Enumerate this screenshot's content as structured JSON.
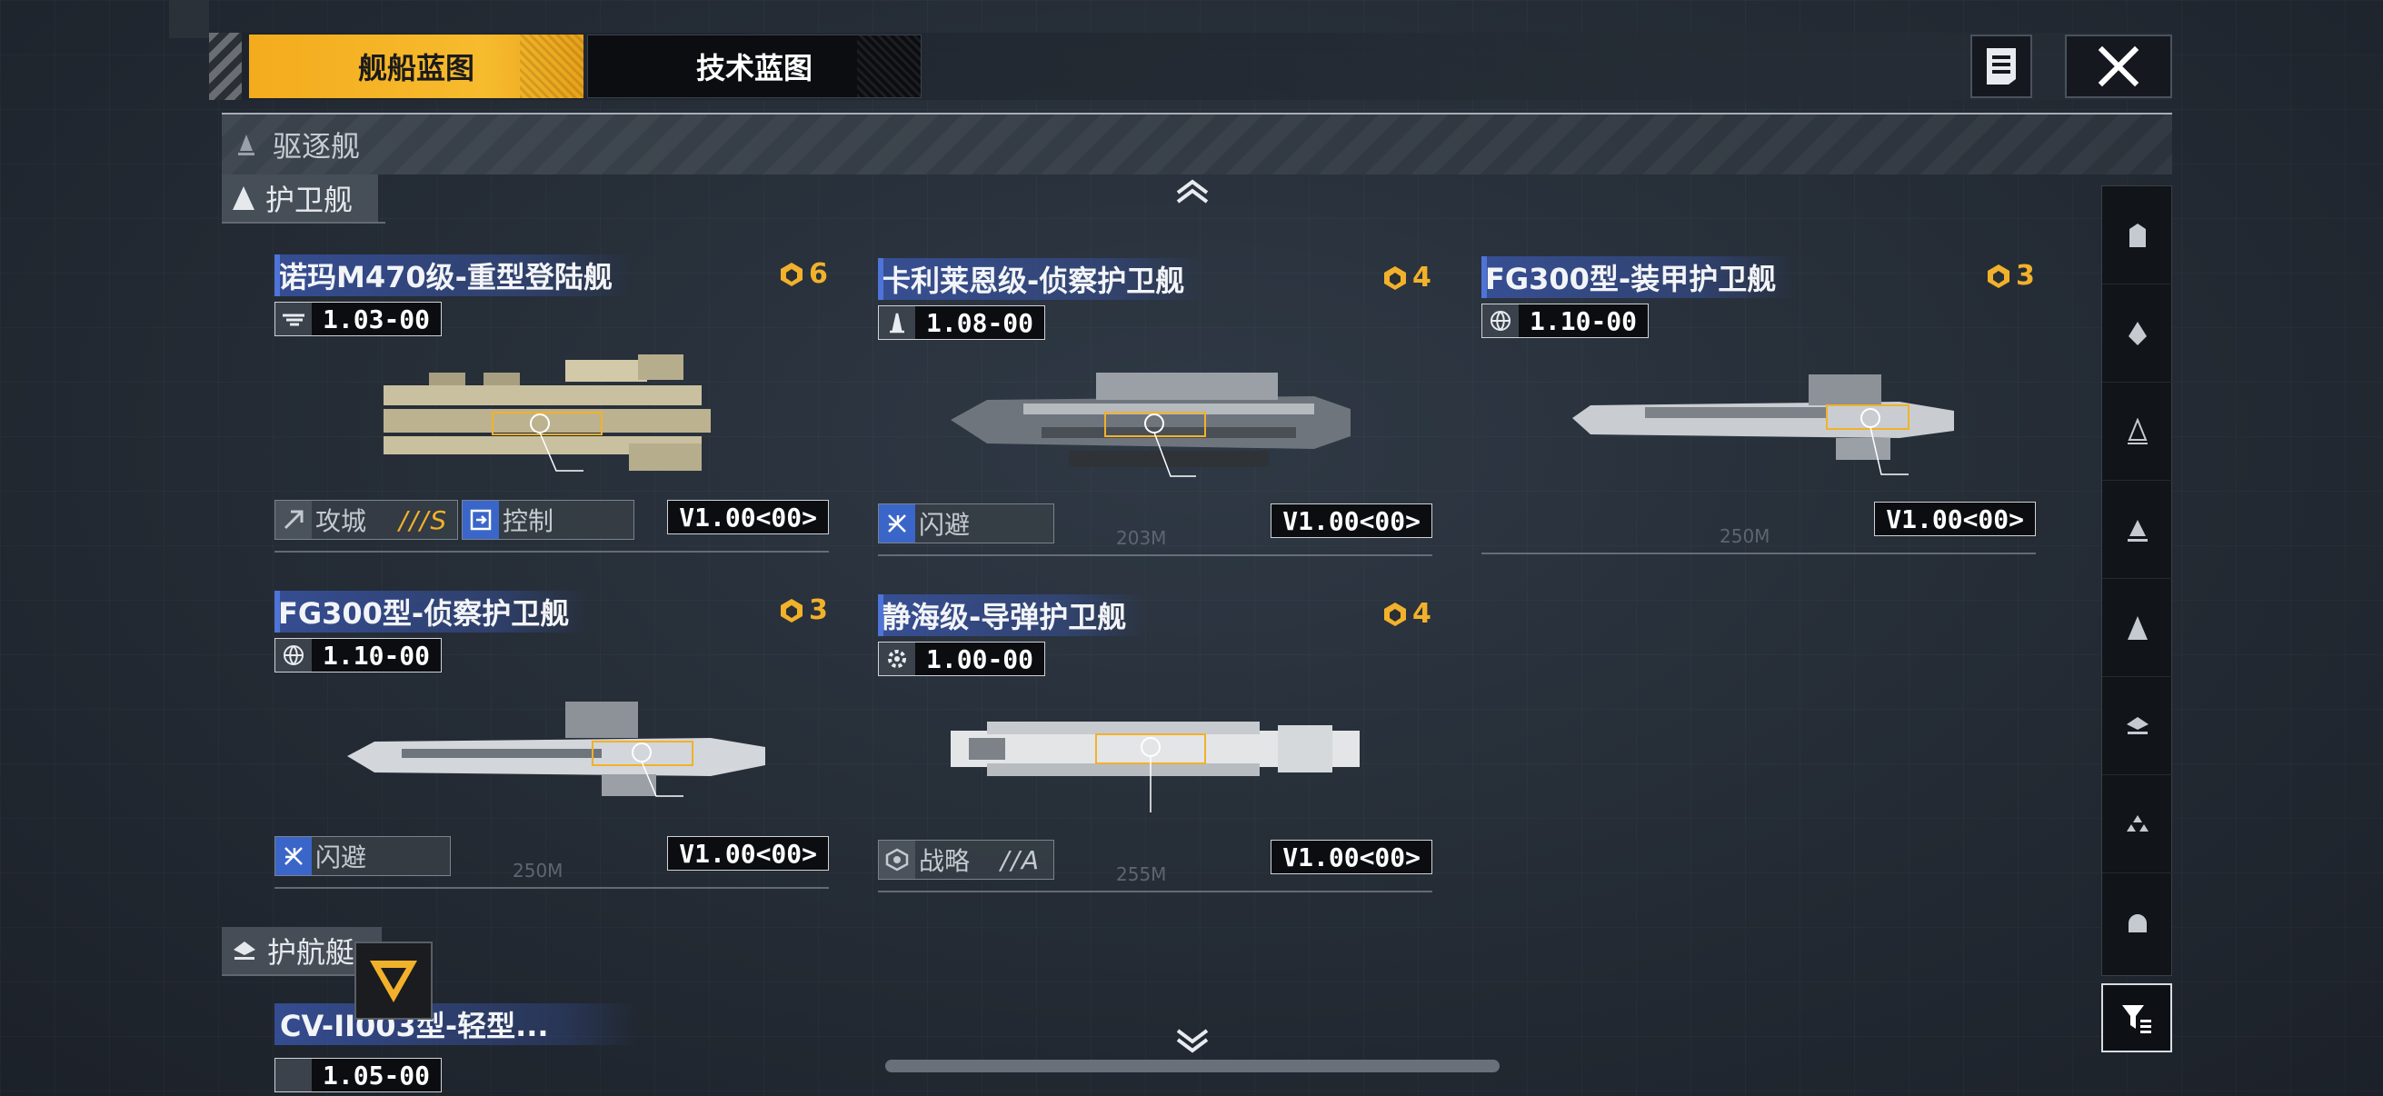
{
  "tabs": {
    "ship_blueprint": "舰船蓝图",
    "tech_blueprint": "技术蓝图"
  },
  "icons": {
    "notes": "notes-icon",
    "close": "close-icon"
  },
  "sections": {
    "destroyer": "驱逐舰",
    "frigate": "护卫舰",
    "escort": "护航艇"
  },
  "ships": [
    {
      "name": "诺玛M470级-重型登陆舰",
      "cost": "6",
      "version": "1.03",
      "version_suffix": "00",
      "tags": [
        {
          "label": "攻城",
          "grade": "///S",
          "style": "gray"
        },
        {
          "label": "控制",
          "grade": "",
          "style": "blue"
        }
      ],
      "version_tag": "V1.00<00>"
    },
    {
      "name": "卡利莱恩级-侦察护卫舰",
      "cost": "4",
      "version": "1.08",
      "version_suffix": "00",
      "tags": [
        {
          "label": "闪避",
          "grade": "",
          "style": "blue"
        }
      ],
      "version_tag": "V1.00<00>",
      "dim": "203M"
    },
    {
      "name": "FG300型-装甲护卫舰",
      "cost": "3",
      "version": "1.10",
      "version_suffix": "00",
      "tags": [],
      "version_tag": "V1.00<00>",
      "dim": "250M"
    },
    {
      "name": "FG300型-侦察护卫舰",
      "cost": "3",
      "version": "1.10",
      "version_suffix": "00",
      "tags": [
        {
          "label": "闪避",
          "grade": "",
          "style": "blue"
        }
      ],
      "version_tag": "V1.00<00>",
      "dim": "250M"
    },
    {
      "name": "静海级-导弹护卫舰",
      "cost": "4",
      "version": "1.00",
      "version_suffix": "00",
      "tags": [
        {
          "label": "战略",
          "grade": "//A",
          "style": "gray"
        }
      ],
      "version_tag": "V1.00<00>",
      "dim": "255M"
    }
  ],
  "peek_ship": {
    "name": "CV-II003型-轻型...",
    "version": "1.05",
    "version_suffix": "00"
  },
  "filter_rail": [
    "class-1-icon",
    "class-2-icon",
    "class-3-icon",
    "class-4-icon",
    "class-5-icon",
    "class-6-icon",
    "class-7-icon",
    "class-8-icon"
  ],
  "colors": {
    "accent": "#f3ac1d",
    "title_blue": "#3a56aa",
    "cost": "#f2b12a"
  }
}
